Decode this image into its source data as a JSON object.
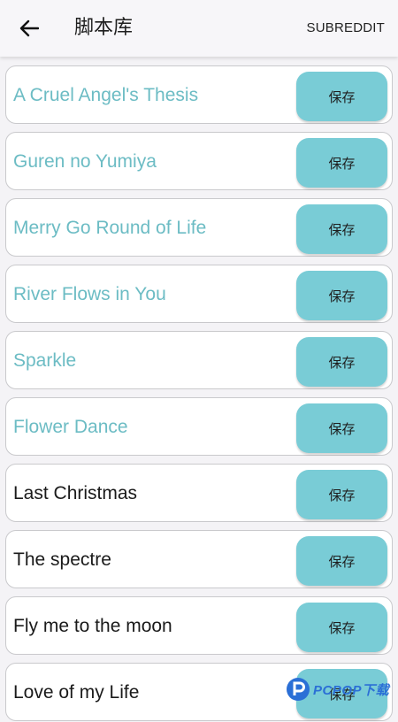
{
  "header": {
    "title": "脚本库",
    "back_icon": "arrow-left-icon",
    "action_label": "SUBREDDIT"
  },
  "colors": {
    "accent_text": "#6cbcc4",
    "button_bg": "#79ccd6",
    "default_text": "#1a1a1a"
  },
  "scripts": [
    {
      "title": "A Cruel Angel's Thesis",
      "save_label": "保存",
      "highlighted": true
    },
    {
      "title": "Guren no Yumiya",
      "save_label": "保存",
      "highlighted": true
    },
    {
      "title": "Merry Go Round of Life",
      "save_label": "保存",
      "highlighted": true
    },
    {
      "title": "River Flows in You",
      "save_label": "保存",
      "highlighted": true
    },
    {
      "title": "Sparkle",
      "save_label": "保存",
      "highlighted": true
    },
    {
      "title": "Flower Dance",
      "save_label": "保存",
      "highlighted": true
    },
    {
      "title": "Last Christmas",
      "save_label": "保存",
      "highlighted": false
    },
    {
      "title": "The spectre",
      "save_label": "保存",
      "highlighted": false
    },
    {
      "title": "Fly me to the moon",
      "save_label": "保存",
      "highlighted": false
    },
    {
      "title": "Love of my Life",
      "save_label": "保存",
      "highlighted": false
    }
  ],
  "watermark": {
    "text": "PCPOP下载"
  }
}
